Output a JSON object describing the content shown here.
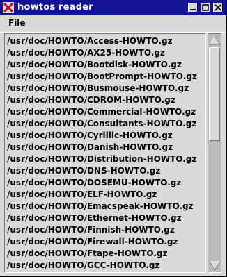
{
  "window": {
    "title": "howtos reader"
  },
  "menu": {
    "file": "File"
  },
  "list": {
    "items": [
      "/usr/doc/HOWTO/Access-HOWTO.gz",
      "/usr/doc/HOWTO/AX25-HOWTO.gz",
      "/usr/doc/HOWTO/Bootdisk-HOWTO.gz",
      "/usr/doc/HOWTO/BootPrompt-HOWTO.gz",
      "/usr/doc/HOWTO/Busmouse-HOWTO.gz",
      "/usr/doc/HOWTO/CDROM-HOWTO.gz",
      "/usr/doc/HOWTO/Commercial-HOWTO.gz",
      "/usr/doc/HOWTO/Consultants-HOWTO.gz",
      "/usr/doc/HOWTO/Cyrillic-HOWTO.gz",
      "/usr/doc/HOWTO/Danish-HOWTO.gz",
      "/usr/doc/HOWTO/Distribution-HOWTO.gz",
      "/usr/doc/HOWTO/DNS-HOWTO.gz",
      "/usr/doc/HOWTO/DOSEMU-HOWTO.gz",
      "/usr/doc/HOWTO/ELF-HOWTO.gz",
      "/usr/doc/HOWTO/Emacspeak-HOWTO.gz",
      "/usr/doc/HOWTO/Ethernet-HOWTO.gz",
      "/usr/doc/HOWTO/Finnish-HOWTO.gz",
      "/usr/doc/HOWTO/Firewall-HOWTO.gz",
      "/usr/doc/HOWTO/Ftape-HOWTO.gz",
      "/usr/doc/HOWTO/GCC-HOWTO.gz"
    ]
  }
}
